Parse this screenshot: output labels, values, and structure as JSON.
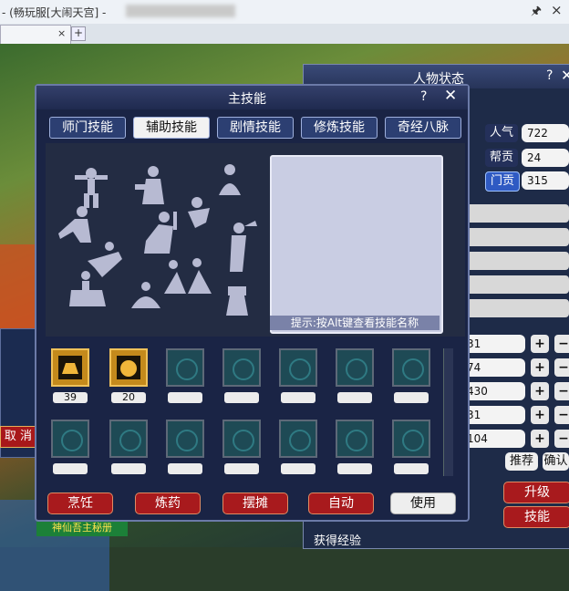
{
  "browser": {
    "title": "- (畅玩服[大闹天宫] - ",
    "tab_close": "×",
    "new_tab": "+",
    "pin_icon": "pin-icon",
    "close_icon": "close-icon"
  },
  "background": {
    "cancel_label": "取 消",
    "bottom_banner": "神仙吾主秘册"
  },
  "status_panel": {
    "title": "人物状态",
    "help": "?",
    "close": "✕",
    "stats": [
      {
        "label": "人气",
        "value": "722"
      },
      {
        "label": "帮贡",
        "value": "24"
      },
      {
        "label": "门贡",
        "value": "315"
      }
    ],
    "attr_values": [
      "31",
      "74",
      "430",
      "31",
      "104"
    ],
    "plus": "+",
    "minus": "−",
    "recommend": "推荐",
    "confirm": "确认",
    "upgrade": "升级",
    "skills": "技能",
    "exp_label": "获得经验"
  },
  "skill_dialog": {
    "title": "主技能",
    "help": "?",
    "close": "✕",
    "tabs": [
      "师门技能",
      "辅助技能",
      "剧情技能",
      "修炼技能",
      "奇经八脉"
    ],
    "active_tab": 1,
    "hint": "提示:按Alt键查看技能名称",
    "slot_values": [
      "39",
      "20"
    ],
    "actions": [
      "烹饪",
      "炼药",
      "摆摊",
      "自动",
      "使用"
    ],
    "colors": {
      "accent_red": "#a81a1d",
      "panel_bg": "#1a2445",
      "slot_gold": "#c48a1c"
    }
  }
}
